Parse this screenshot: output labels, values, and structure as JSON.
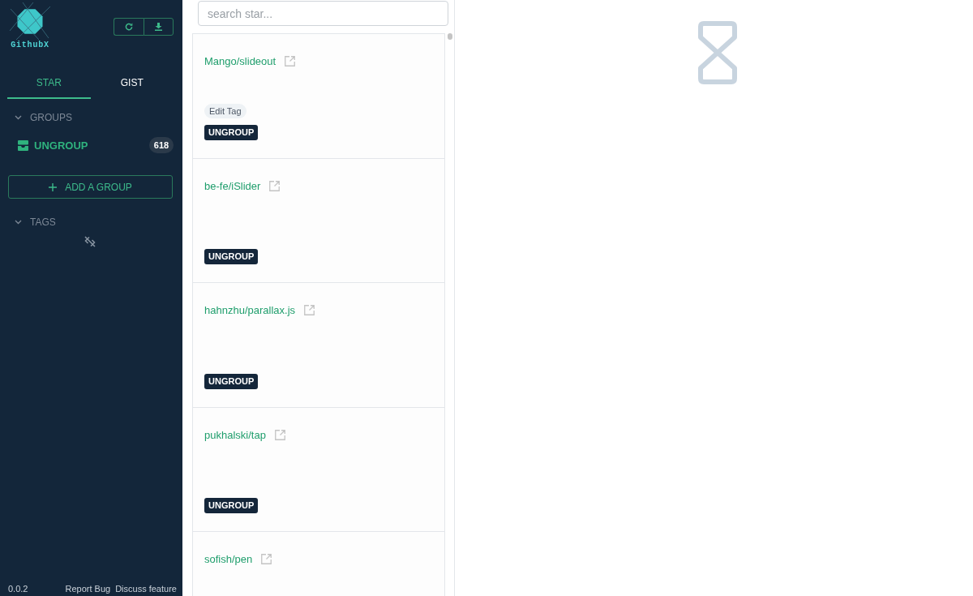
{
  "sidebar": {
    "logo": {
      "text": "GithubX"
    },
    "tabs": [
      {
        "label": "STAR",
        "selected": true
      },
      {
        "label": "GIST",
        "selected": false
      }
    ],
    "groups": {
      "title": "GROUPS",
      "expanded": true,
      "items": [
        {
          "label": "UNGROUP",
          "count": "618",
          "selected": true
        }
      ]
    },
    "add_group_button": {
      "label": "ADD A GROUP"
    },
    "tags": {
      "title": "TAGS",
      "expanded": true
    },
    "footer": {
      "version": "0.0.2",
      "links": [
        "Report Bug",
        "Discuss feature"
      ]
    }
  },
  "star_list": {
    "search": {
      "placeholder": "search star..."
    },
    "items": [
      {
        "name": "Mango/slideout",
        "edit_tag": "Edit Tag",
        "group": "UNGROUP"
      },
      {
        "name": "be-fe/iSlider",
        "group": "UNGROUP"
      },
      {
        "name": "hahnzhu/parallax.js",
        "group": "UNGROUP"
      },
      {
        "name": "pukhalski/tap",
        "group": "UNGROUP"
      },
      {
        "name": "sofish/pen"
      }
    ]
  }
}
